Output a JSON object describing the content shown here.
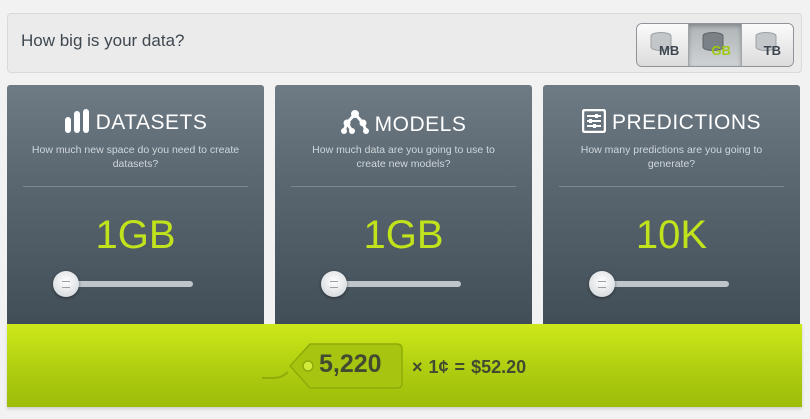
{
  "header": {
    "title": "How big is your data?"
  },
  "units": [
    {
      "label": "MB",
      "active": false
    },
    {
      "label": "GB",
      "active": true
    },
    {
      "label": "TB",
      "active": false
    }
  ],
  "cards": [
    {
      "title": "DATASETS",
      "icon": "bars-icon",
      "description": "How much new space do you need to create datasets?",
      "value": "1GB",
      "slider_level": 0
    },
    {
      "title": "MODELS",
      "icon": "tree-icon",
      "description": "How much data are you going to use to create new models?",
      "value": "1GB",
      "slider_level": 0
    },
    {
      "title": "PREDICTIONS",
      "icon": "sliders-icon",
      "description": "How many predictions are you going to generate?",
      "value": "10K",
      "slider_level": 0
    }
  ],
  "cost": {
    "credits": "5,220",
    "times": "×",
    "unit_price": "1¢",
    "equals": "=",
    "total": "$52.20"
  },
  "colors": {
    "accent": "#c1e31c",
    "card_top": "#6e7b85",
    "card_bottom": "#424e57",
    "bottom_bar": "#b7d612"
  }
}
